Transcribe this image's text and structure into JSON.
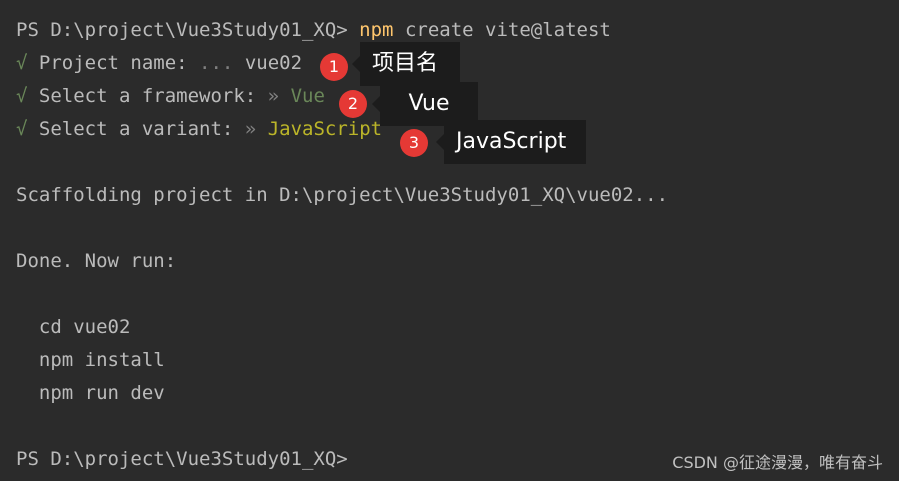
{
  "terminal": {
    "line1": {
      "prompt": "PS D:\\project\\Vue3Study01_XQ> ",
      "cmd": "npm",
      "rest": " create vite@latest"
    },
    "line2": {
      "check": "√",
      "label": " Project name: ",
      "dots": "... ",
      "value": "vue02"
    },
    "line3": {
      "check": "√",
      "label": " Select a framework: ",
      "arrow": "» ",
      "value": "Vue"
    },
    "line4": {
      "check": "√",
      "label": " Select a variant: ",
      "arrow": "» ",
      "value": "JavaScript"
    },
    "line5": "Scaffolding project in D:\\project\\Vue3Study01_XQ\\vue02...",
    "line6": "Done. Now run:",
    "line7": "  cd vue02",
    "line8": "  npm install",
    "line9": "  npm run dev",
    "line10": "PS D:\\project\\Vue3Study01_XQ>"
  },
  "annotations": [
    {
      "number": "1",
      "text": "项目名"
    },
    {
      "number": "2",
      "text": "Vue"
    },
    {
      "number": "3",
      "text": "JavaScript"
    }
  ],
  "watermark": "CSDN @征途漫漫，唯有奋斗",
  "colors": {
    "background": "#2b2b2b",
    "npm_command": "#ffc66d",
    "success_check": "#6a8759",
    "variant_value": "#bbb529",
    "badge": "#e53935",
    "callout_bg": "#1c1c1c"
  }
}
